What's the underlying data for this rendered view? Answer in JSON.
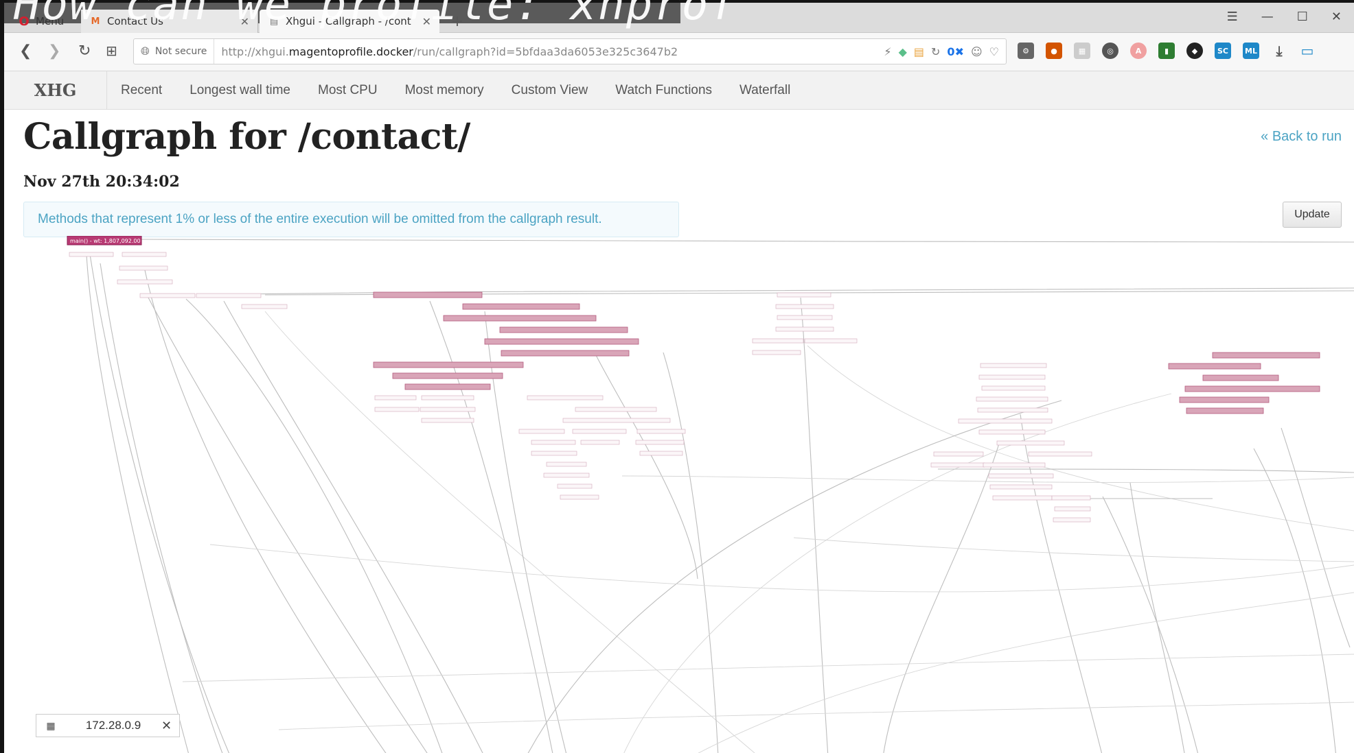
{
  "slide": {
    "title": "How can we profile: xhprof"
  },
  "tabs": {
    "menu_label": "Menu",
    "tab1_title": "Contact Us",
    "tab2_title": "Xhgui - Callgraph - /cont",
    "new_tab": "+"
  },
  "address": {
    "security_label": "Not secure",
    "url_prefix": "http://xhgui.",
    "url_host": "magentoprofile.docker",
    "url_path": "/run/callgraph?id=5bfdaa3da6053e325c3647b2",
    "badge_count": "0"
  },
  "nav": {
    "brand": "XHG",
    "links": [
      "Recent",
      "Longest wall time",
      "Most CPU",
      "Most memory",
      "Custom View",
      "Watch Functions",
      "Waterfall"
    ]
  },
  "page": {
    "title": "Callgraph for /contact/",
    "back_link": "« Back to run",
    "run_date": "Nov 27th 20:34:02",
    "notice": "Methods that represent 1% or less of the entire execution will be omitted from the callgraph result.",
    "update_button": "Update"
  },
  "graph": {
    "root_label": "main() - wt: 1,807,092.00"
  },
  "ip_chip": {
    "value": "172.28.0.9"
  },
  "colors": {
    "accent": "#4ba3c3",
    "root_node": "#b83a73"
  },
  "icons": [
    "opera-logo-icon",
    "magento-icon",
    "page-icon",
    "back-icon",
    "forward-icon",
    "reload-icon",
    "speed-dial-icon",
    "globe-icon",
    "close-icon"
  ]
}
